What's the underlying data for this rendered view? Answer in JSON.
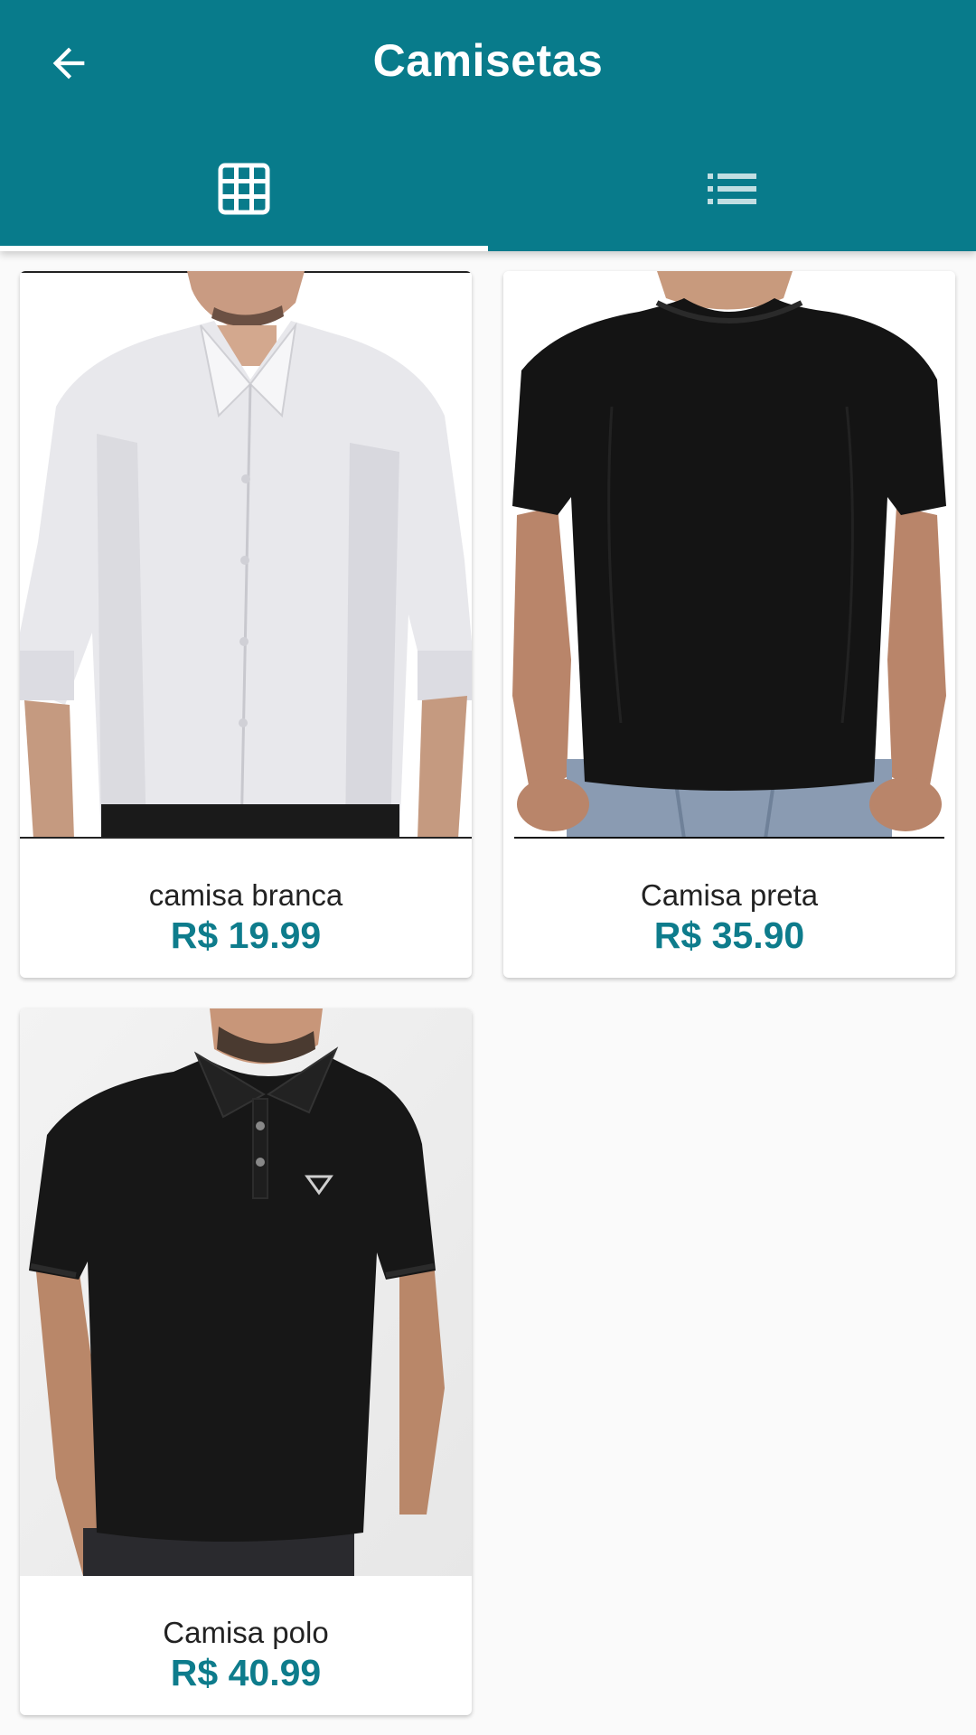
{
  "header": {
    "title": "Camisetas",
    "back_icon": "arrow-back-icon",
    "background": "#087b8b"
  },
  "tabs": [
    {
      "icon": "grid-view-icon",
      "selected": true
    },
    {
      "icon": "list-view-icon",
      "selected": false
    }
  ],
  "products": [
    {
      "name": "camisa branca",
      "price": "R$ 19.99",
      "image": "white-dress-shirt"
    },
    {
      "name": "Camisa preta",
      "price": "R$ 35.90",
      "image": "black-t-shirt"
    },
    {
      "name": "Camisa polo",
      "price": "R$ 40.99",
      "image": "black-polo-shirt"
    }
  ],
  "colors": {
    "accent": "#087b8b",
    "price": "#0e7c8c"
  }
}
